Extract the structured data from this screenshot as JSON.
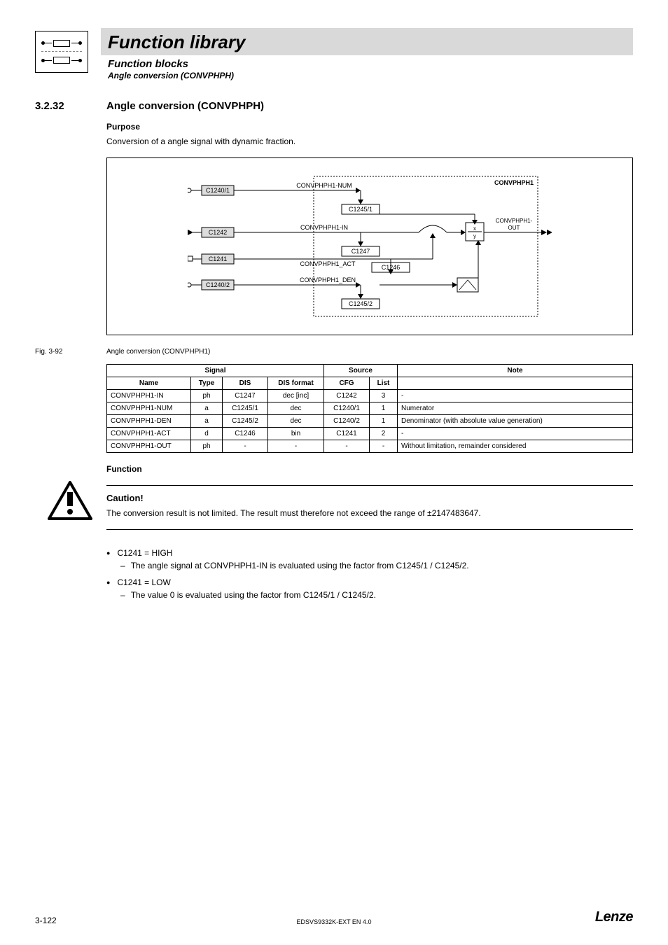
{
  "header": {
    "title": "Function library",
    "sub1": "Function blocks",
    "sub2": "Angle conversion (CONVPHPH)"
  },
  "section": {
    "num": "3.2.32",
    "title": "Angle conversion (CONVPHPH)"
  },
  "purpose": {
    "heading": "Purpose",
    "text": "Conversion of a angle signal with dynamic fraction."
  },
  "diagram": {
    "block_name": "CONVPHPH1",
    "labels": {
      "num": "CONVPHPH1-NUM",
      "in": "CONVPHPH1-IN",
      "act": "CONVPHPH1_ACT",
      "den": "CONVPHPH1_DEN",
      "out": "CONVPHPH1-OUT"
    },
    "codes": {
      "c12401": "C1240/1",
      "c12451": "C1245/1",
      "c1242": "C1242",
      "c1247": "C1247",
      "c1241": "C1241",
      "c1246": "C1246",
      "c12402": "C1240/2",
      "c12452": "C1245/2"
    },
    "frac": {
      "x": "x",
      "y": "y"
    }
  },
  "figure": {
    "label": "Fig. 3-92",
    "caption": "Angle conversion (CONVPHPH1)"
  },
  "table": {
    "headers": {
      "signal": "Signal",
      "source": "Source",
      "note": "Note",
      "name": "Name",
      "type": "Type",
      "dis": "DIS",
      "dis_format": "DIS format",
      "cfg": "CFG",
      "list": "List"
    },
    "rows": [
      {
        "name": "CONVPHPH1-IN",
        "type": "ph",
        "dis": "C1247",
        "fmt": "dec [inc]",
        "cfg": "C1242",
        "list": "3",
        "note": "-"
      },
      {
        "name": "CONVPHPH1-NUM",
        "type": "a",
        "dis": "C1245/1",
        "fmt": "dec",
        "cfg": "C1240/1",
        "list": "1",
        "note": "Numerator"
      },
      {
        "name": "CONVPHPH1-DEN",
        "type": "a",
        "dis": "C1245/2",
        "fmt": "dec",
        "cfg": "C1240/2",
        "list": "1",
        "note": "Denominator (with absolute value generation)"
      },
      {
        "name": "CONVPHPH1-ACT",
        "type": "d",
        "dis": "C1246",
        "fmt": "bin",
        "cfg": "C1241",
        "list": "2",
        "note": "-"
      },
      {
        "name": "CONVPHPH1-OUT",
        "type": "ph",
        "dis": "-",
        "fmt": "-",
        "cfg": "-",
        "list": "-",
        "note": "Without limitation, remainder considered"
      }
    ]
  },
  "function": {
    "heading": "Function"
  },
  "caution": {
    "title": "Caution!",
    "body": "The conversion result is not limited. The result must therefore not exceed the range of ±2147483647."
  },
  "bullets": [
    {
      "text": "C1241 = HIGH",
      "sub": [
        "The angle signal at CONVPHPH1-IN is evaluated using the factor from C1245/1 / C1245/2."
      ]
    },
    {
      "text": "C1241 = LOW",
      "sub": [
        "The value 0 is evaluated using the factor from C1245/1 / C1245/2."
      ]
    }
  ],
  "footer": {
    "page": "3-122",
    "doc": "EDSVS9332K-EXT EN 4.0",
    "brand": "Lenze"
  }
}
